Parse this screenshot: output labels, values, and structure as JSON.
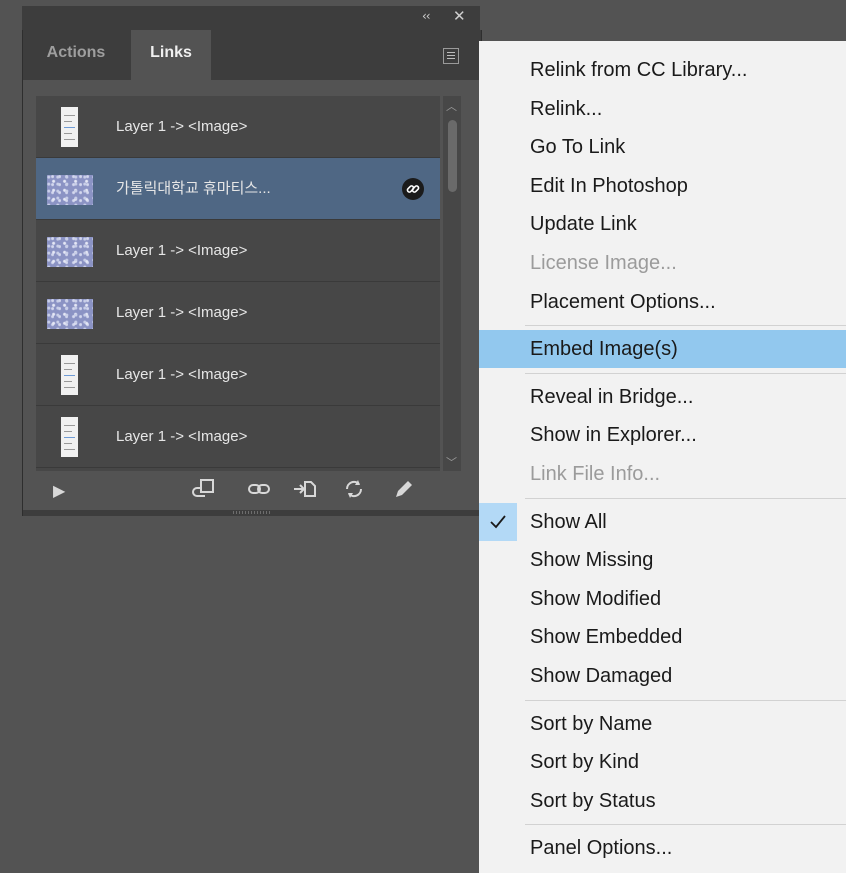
{
  "panel": {
    "tabs": [
      "Actions",
      "Links"
    ],
    "active_tab": "Links",
    "collapse_glyph": "‹‹",
    "close_glyph": "✕",
    "rows": [
      {
        "label": "Layer 1 -> <Image>",
        "thumb": "portrait"
      },
      {
        "label": "가톨릭대학교 휴마티스...",
        "thumb": "landscape",
        "selected": true,
        "badge": "link-icon"
      },
      {
        "label": "Layer 1 -> <Image>",
        "thumb": "landscape"
      },
      {
        "label": "Layer 1 -> <Image>",
        "thumb": "landscape"
      },
      {
        "label": "Layer 1 -> <Image>",
        "thumb": "portrait"
      },
      {
        "label": "Layer 1 -> <Image>",
        "thumb": "portrait"
      }
    ],
    "toolbar_icons": [
      "play-icon",
      "relink-from-library-icon",
      "relink-icon",
      "go-to-link-icon",
      "update-link-icon",
      "edit-original-icon"
    ]
  },
  "menu": {
    "items": [
      {
        "label": "Relink from CC Library...",
        "enabled": true
      },
      {
        "label": "Relink...",
        "enabled": true
      },
      {
        "label": "Go To Link",
        "enabled": true
      },
      {
        "label": "Edit In Photoshop",
        "enabled": true
      },
      {
        "label": "Update Link",
        "enabled": true
      },
      {
        "label": "License Image...",
        "enabled": false
      },
      {
        "label": "Placement Options...",
        "enabled": true
      },
      {
        "separator": true
      },
      {
        "label": "Embed Image(s)",
        "enabled": true,
        "highlighted": true
      },
      {
        "separator": true
      },
      {
        "label": "Reveal in Bridge...",
        "enabled": true
      },
      {
        "label": "Show in Explorer...",
        "enabled": true
      },
      {
        "label": "Link File Info...",
        "enabled": false
      },
      {
        "separator": true
      },
      {
        "label": "Show All",
        "enabled": true,
        "checked": true
      },
      {
        "label": "Show Missing",
        "enabled": true
      },
      {
        "label": "Show Modified",
        "enabled": true
      },
      {
        "label": "Show Embedded",
        "enabled": true
      },
      {
        "label": "Show Damaged",
        "enabled": true
      },
      {
        "separator": true
      },
      {
        "label": "Sort by Name",
        "enabled": true
      },
      {
        "label": "Sort by Kind",
        "enabled": true
      },
      {
        "label": "Sort by Status",
        "enabled": true
      },
      {
        "separator": true
      },
      {
        "label": "Panel Options...",
        "enabled": true
      }
    ]
  },
  "colors": {
    "selection": "#4f6784",
    "menu_highlight": "#92c8ee",
    "menu_bg": "#f2f2f2",
    "panel_bg": "#535353"
  }
}
